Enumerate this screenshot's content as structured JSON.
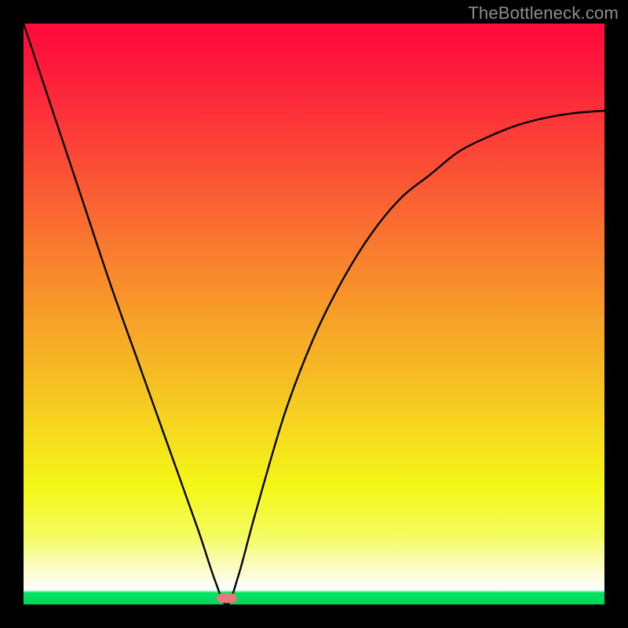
{
  "watermark": "TheBottleneck.com",
  "chart_data": {
    "type": "line",
    "title": "",
    "xlabel": "",
    "ylabel": "",
    "xlim": [
      0,
      100
    ],
    "ylim": [
      0,
      100
    ],
    "grid": false,
    "background_gradient": {
      "top": "#ff0a3c",
      "mid_upper": "#f9792f",
      "mid": "#f5e31c",
      "lower_band": "#ffffff",
      "bottom": "#00d45d"
    },
    "series": [
      {
        "name": "bottleneck-curve",
        "color": "#000000",
        "x": [
          0,
          5,
          10,
          15,
          20,
          25,
          30,
          33,
          35,
          37,
          40,
          45,
          50,
          55,
          60,
          65,
          70,
          75,
          80,
          85,
          90,
          95,
          100
        ],
        "y": [
          100,
          85,
          70,
          55,
          41,
          27,
          13,
          4,
          0,
          5,
          16,
          33,
          46,
          56,
          64,
          70,
          74,
          78,
          80.5,
          82.5,
          83.8,
          84.6,
          85
        ]
      }
    ],
    "marker": {
      "name": "optimal-point",
      "x": 35,
      "color": "#e37b7a"
    }
  }
}
